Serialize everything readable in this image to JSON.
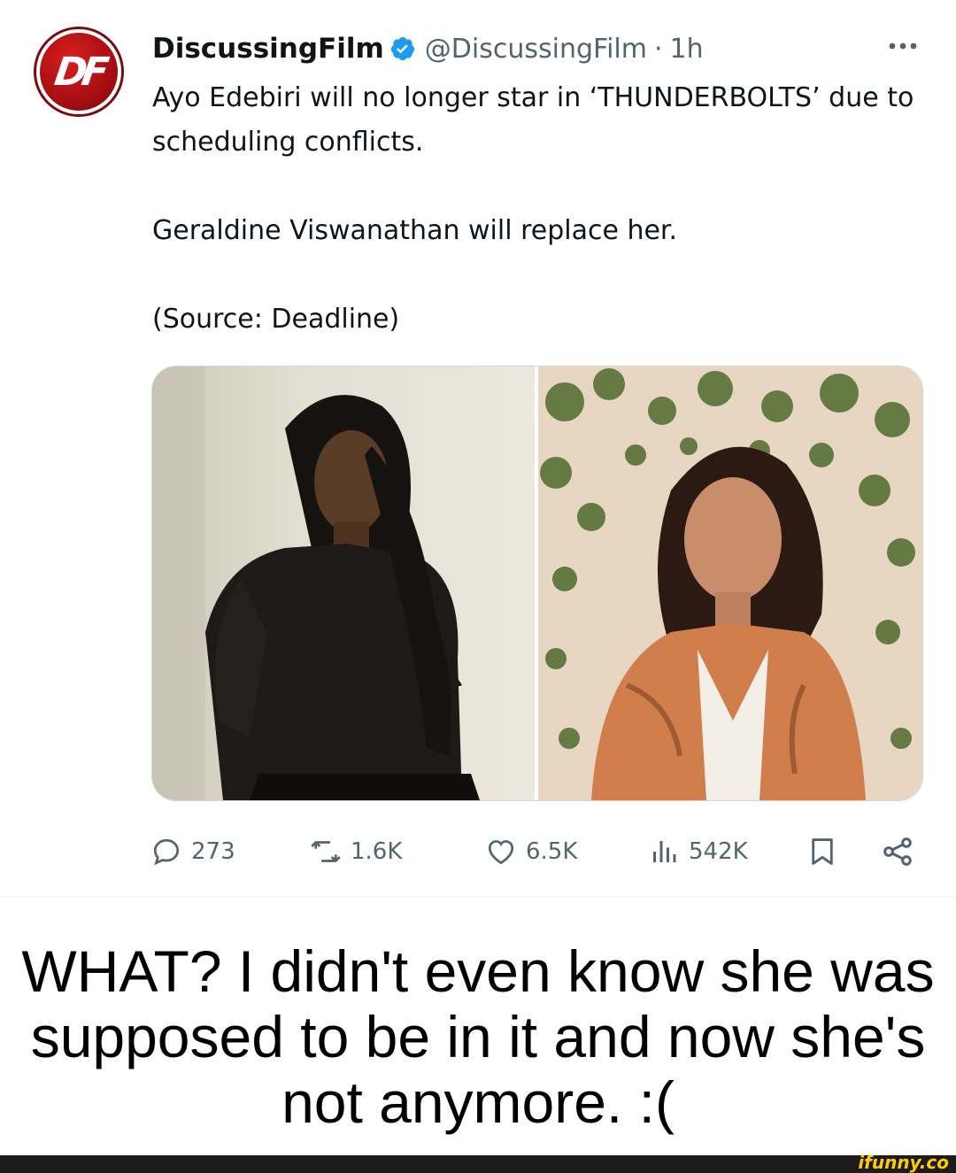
{
  "tweet": {
    "avatar_logo": "DF",
    "display_name": "DiscussingFilm",
    "handle": "@DiscussingFilm",
    "separator": "·",
    "time": "1h",
    "text_paragraphs": [
      "Ayo Edebiri will no longer star in ‘THUNDERBOLTS’ due to scheduling conflicts.",
      "Geraldine Viswanathan will replace her.",
      "(Source: Deadline)"
    ],
    "media": [
      {
        "icon": "photo-portrait-icon",
        "alt": ""
      },
      {
        "icon": "photo-portrait-icon",
        "alt": ""
      }
    ],
    "actions": {
      "replies": "273",
      "reposts": "1.6K",
      "likes": "6.5K",
      "views": "542K"
    },
    "icons": [
      "verified-icon",
      "more-icon",
      "reply-icon",
      "repost-icon",
      "like-icon",
      "views-icon",
      "bookmark-icon",
      "share-icon"
    ]
  },
  "caption": {
    "text": "WHAT? I didn't even know she was supposed to be in it and now she's not anymore. :("
  },
  "footer": {
    "watermark": "ifunny.co"
  },
  "colors": {
    "text_primary": "#0f1419",
    "text_secondary": "#536471",
    "verified": "#1d9bf0",
    "avatar_red": "#a80f14",
    "footer_bg": "#1b1b1b",
    "watermark": "#ffcc00"
  }
}
